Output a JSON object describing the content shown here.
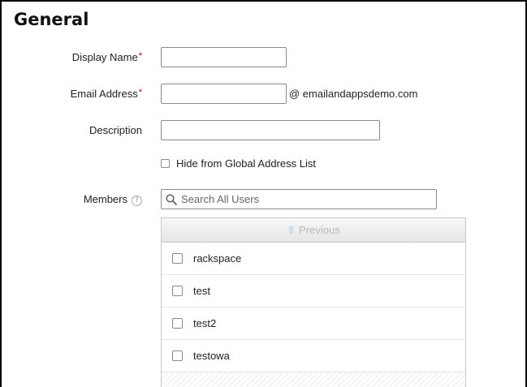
{
  "section": {
    "title": "General"
  },
  "form": {
    "display_name": {
      "label": "Display Name",
      "required": "*",
      "value": ""
    },
    "email": {
      "label": "Email Address",
      "required": "*",
      "value": "",
      "domain": "@ emailandappsdemo.com"
    },
    "description": {
      "label": "Description",
      "value": ""
    },
    "hide_gal": {
      "label": "Hide from Global Address List",
      "checked": false
    },
    "members": {
      "label": "Members",
      "help_glyph": "?",
      "search_placeholder": "Search All Users",
      "previous_label": "Previous",
      "users": [
        {
          "name": "rackspace",
          "checked": false
        },
        {
          "name": "test",
          "checked": false
        },
        {
          "name": "test2",
          "checked": false
        },
        {
          "name": "testowa",
          "checked": false
        }
      ]
    }
  },
  "colors": {
    "required": "#b00020",
    "previous_arrow": "#8fc1e8",
    "previous_text": "#b8b8b8"
  }
}
